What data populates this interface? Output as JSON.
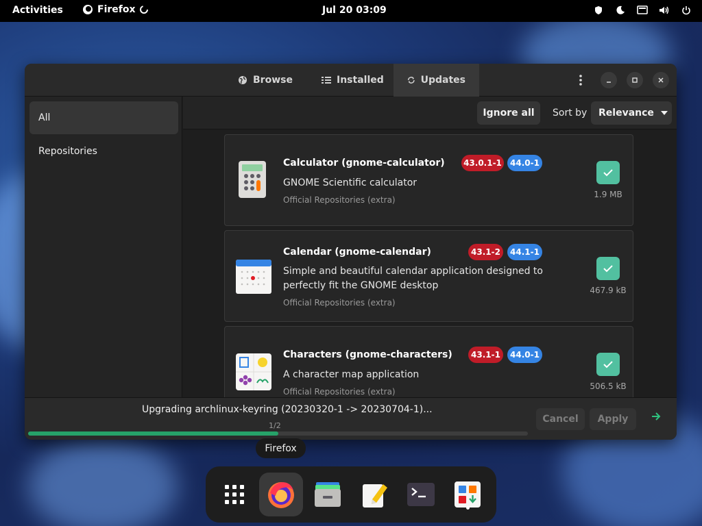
{
  "topbar": {
    "activities": "Activities",
    "app_name": "Firefox",
    "clock": "Jul 20  03:09"
  },
  "window": {
    "tabs": [
      {
        "label": "Browse",
        "icon": "globe-icon"
      },
      {
        "label": "Installed",
        "icon": "list-icon"
      },
      {
        "label": "Updates",
        "icon": "refresh-icon",
        "active": true
      }
    ],
    "sidebar": {
      "items": [
        {
          "label": "All",
          "active": true
        },
        {
          "label": "Repositories"
        }
      ]
    },
    "toolbar": {
      "ignore_all": "Ignore all",
      "sort_by": "Sort by",
      "sort_value": "Relevance"
    },
    "updates": [
      {
        "name": "Calculator (gnome-calculator)",
        "old_version": "43.0.1-1",
        "new_version": "44.0-1",
        "description": "GNOME Scientific calculator",
        "repository": "Official Repositories (extra)",
        "size": "1.9 MB",
        "checked": true,
        "icon": "calculator-icon"
      },
      {
        "name": "Calendar (gnome-calendar)",
        "old_version": "43.1-2",
        "new_version": "44.1-1",
        "description": "Simple and beautiful calendar application designed to perfectly fit the GNOME desktop",
        "repository": "Official Repositories (extra)",
        "size": "467.9 kB",
        "checked": true,
        "icon": "calendar-icon"
      },
      {
        "name": "Characters (gnome-characters)",
        "old_version": "43.1-1",
        "new_version": "44.0-1",
        "description": "A character map application",
        "repository": "Official Repositories (extra)",
        "size": "506.5 kB",
        "checked": true,
        "icon": "characters-icon"
      }
    ],
    "bottom": {
      "status": "Upgrading archlinux-keyring (20230320-1 -> 20230704-1)...",
      "progress_label": "1/2",
      "progress": 0.5,
      "cancel": "Cancel",
      "apply": "Apply"
    }
  },
  "tooltip": "Firefox",
  "dock": {
    "items": [
      "apps-grid-icon",
      "firefox-icon",
      "files-icon",
      "text-editor-icon",
      "terminal-icon",
      "software-icon"
    ]
  },
  "colors": {
    "accent_green": "#26a269",
    "check_teal": "#52c0a0",
    "old_version_red": "#c01c28",
    "new_version_blue": "#3584e4"
  }
}
